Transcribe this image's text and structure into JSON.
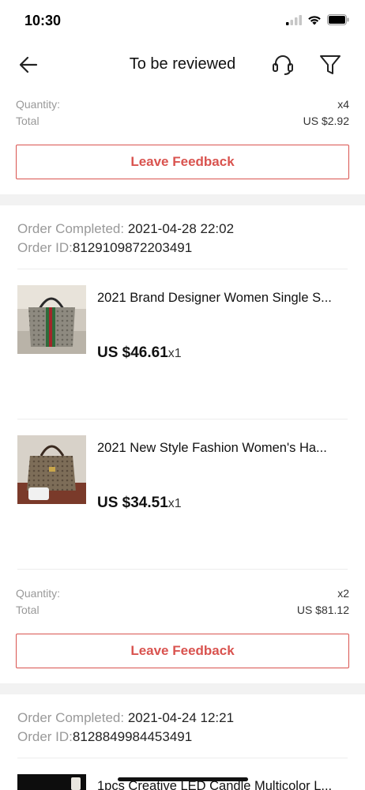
{
  "status_bar": {
    "time": "10:30"
  },
  "nav": {
    "title": "To be reviewed",
    "back_icon": "arrow-left-icon",
    "service_icon": "headset-icon",
    "filter_icon": "filter-icon"
  },
  "top_summary": {
    "quantity_label": "Quantity:",
    "quantity_value": "x4",
    "total_label": "Total",
    "total_value": "US $2.92",
    "feedback_label": "Leave Feedback"
  },
  "orders": [
    {
      "completed_label": "Order Completed: ",
      "completed_value": "2021-04-28 22:02",
      "id_label": "Order ID:",
      "id_value": "8129109872203491",
      "products": [
        {
          "title": "2021 Brand Designer Women Single S...",
          "price": "US $46.61",
          "qty": "x1"
        },
        {
          "title": "2021 New Style Fashion Women's Ha...",
          "price": "US $34.51",
          "qty": "x1"
        }
      ],
      "quantity_label": "Quantity:",
      "quantity_value": "x2",
      "total_label": "Total",
      "total_value": "US $81.12",
      "feedback_label": "Leave Feedback"
    },
    {
      "completed_label": "Order Completed: ",
      "completed_value": "2021-04-24 12:21",
      "id_label": "Order ID:",
      "id_value": "8128849984453491",
      "products": [
        {
          "title": "1pcs Creative LED Candle Multicolor L..."
        }
      ]
    }
  ],
  "colors": {
    "accent": "#d9534f",
    "muted_text": "#999999",
    "band": "#f2f2f2"
  }
}
